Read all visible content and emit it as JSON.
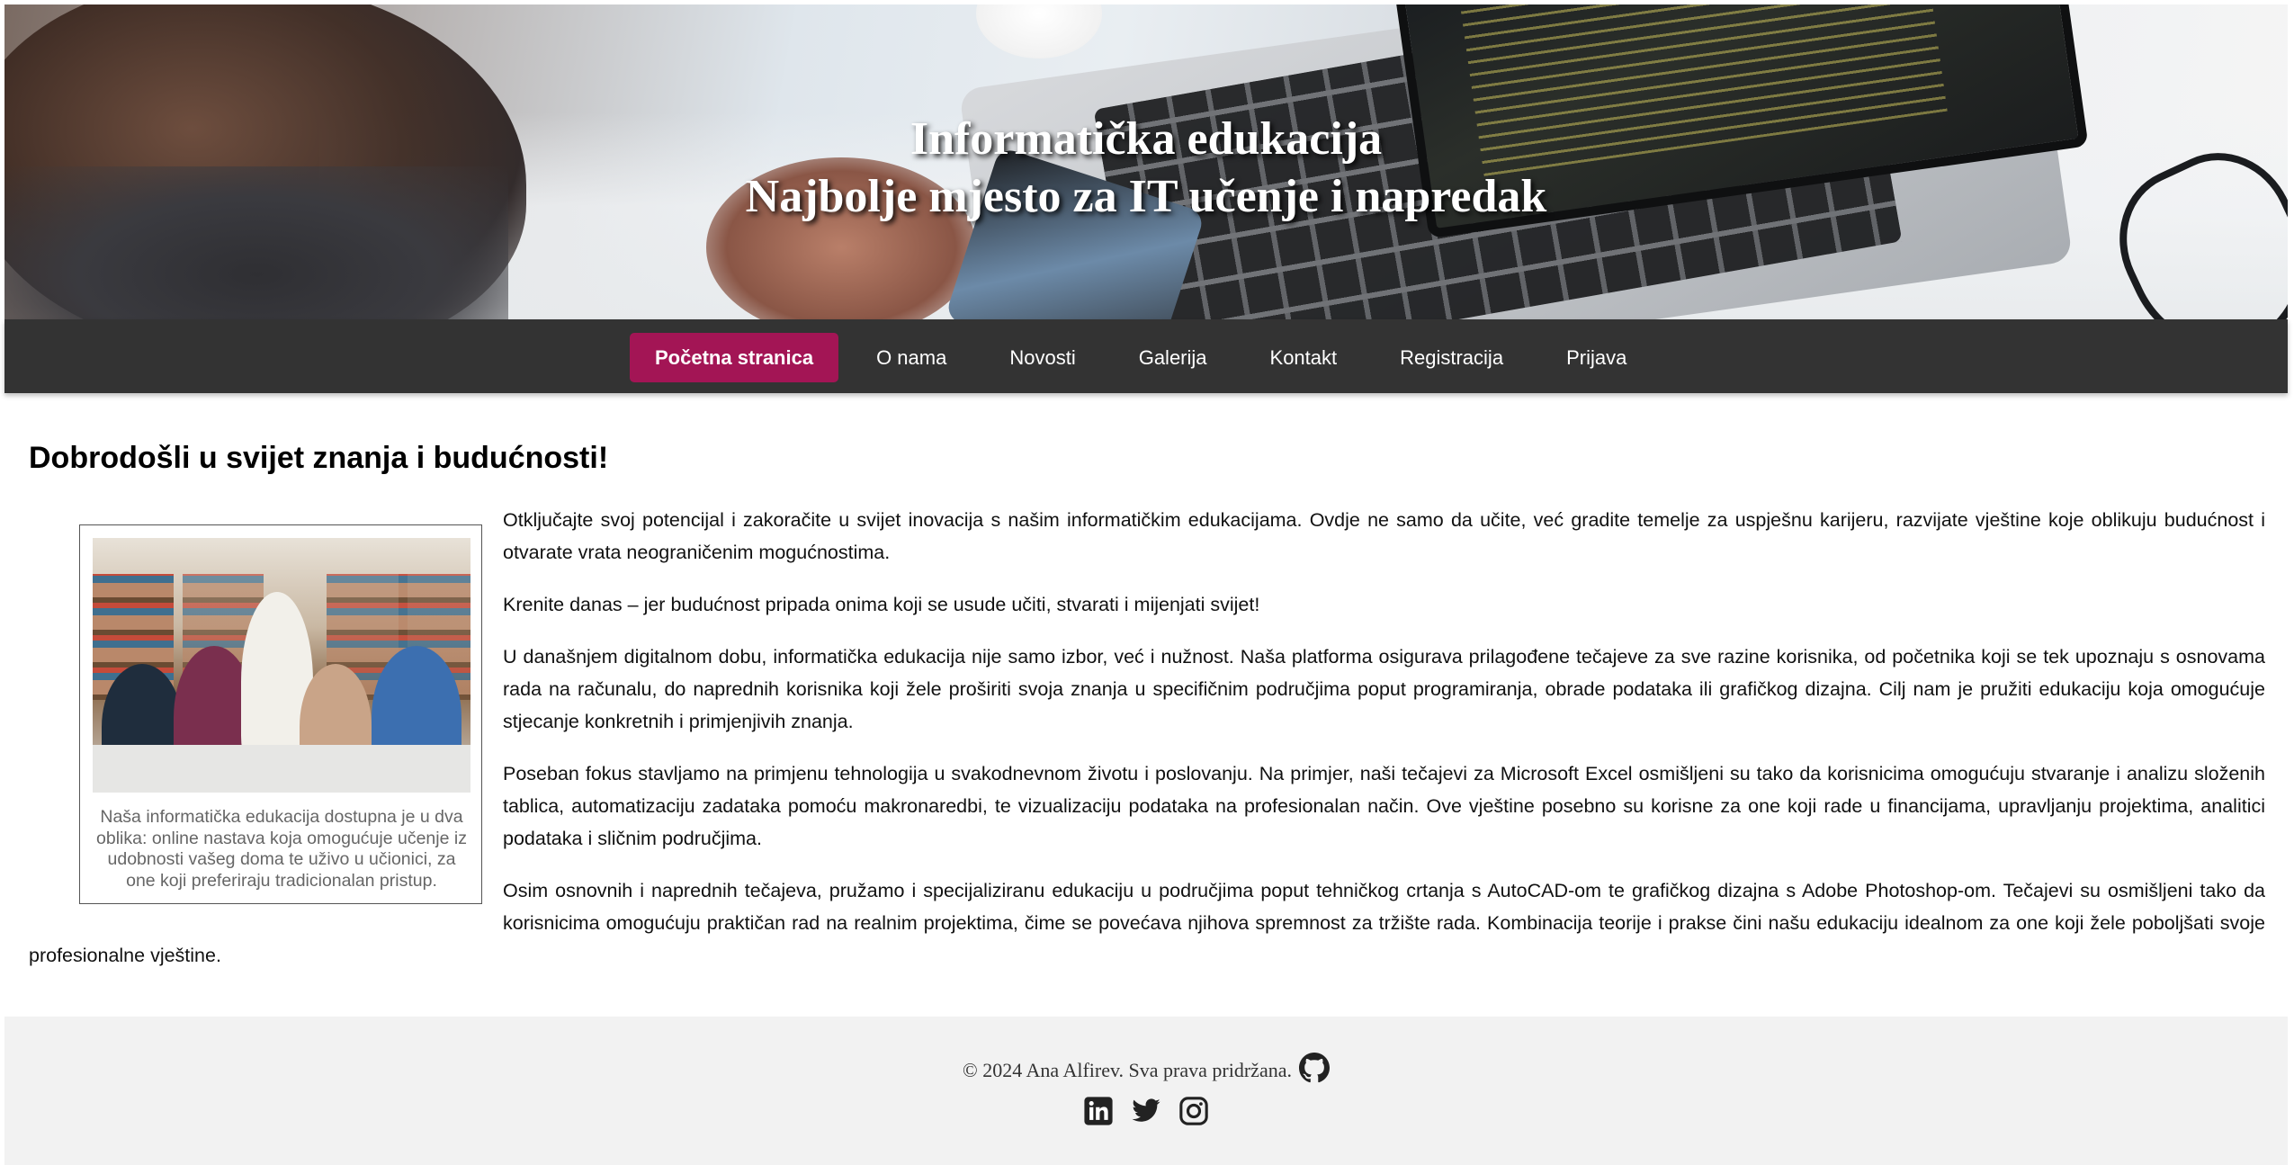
{
  "hero": {
    "title_line1": "Informatička edukacija",
    "title_line2": "Najbolje mjesto za IT učenje i napredak"
  },
  "nav": {
    "items": [
      {
        "label": "Početna stranica",
        "active": true
      },
      {
        "label": "O nama",
        "active": false
      },
      {
        "label": "Novosti",
        "active": false
      },
      {
        "label": "Galerija",
        "active": false
      },
      {
        "label": "Kontakt",
        "active": false
      },
      {
        "label": "Registracija",
        "active": false
      },
      {
        "label": "Prijava",
        "active": false
      }
    ],
    "active_color": "#a31555",
    "background": "#333333"
  },
  "main": {
    "heading": "Dobrodošli u svijet znanja i budućnosti!",
    "figure_caption": "Naša informatička edukacija dostupna je u dva oblika: online nastava koja omogućuje učenje iz udobnosti vašeg doma te uživo u učionici, za one koji preferiraju tradicionalan pristup.",
    "paragraphs": [
      "Otključajte svoj potencijal i zakoračite u svijet inovacija s našim informatičkim edukacijama. Ovdje ne samo da učite, već gradite temelje za uspješnu karijeru, razvijate vještine koje oblikuju budućnost i otvarate vrata neograničenim mogućnostima.",
      "Krenite danas – jer budućnost pripada onima koji se usude učiti, stvarati i mijenjati svijet!",
      "U današnjem digitalnom dobu, informatička edukacija nije samo izbor, već i nužnost. Naša platforma osigurava prilagođene tečajeve za sve razine korisnika, od početnika koji se tek upoznaju s osnovama rada na računalu, do naprednih korisnika koji žele proširiti svoja znanja u specifičnim područjima poput programiranja, obrade podataka ili grafičkog dizajna. Cilj nam je pružiti edukaciju koja omogućuje stjecanje konkretnih i primjenjivih znanja.",
      "Poseban fokus stavljamo na primjenu tehnologija u svakodnevnom životu i poslovanju. Na primjer, naši tečajevi za Microsoft Excel osmišljeni su tako da korisnicima omogućuju stvaranje i analizu složenih tablica, automatizaciju zadataka pomoću makronaredbi, te vizualizaciju podataka na profesionalan način. Ove vještine posebno su korisne za one koji rade u financijama, upravljanju projektima, analitici podataka i sličnim područjima.",
      "Osim osnovnih i naprednih tečajeva, pružamo i specijaliziranu edukaciju u područjima poput tehničkog crtanja s AutoCAD-om te grafičkog dizajna s Adobe Photoshop-om. Tečajevi su osmišljeni tako da korisnicima omogućuju praktičan rad na realnim projektima, čime se povećava njihova spremnost za tržište rada. Kombinacija teorije i prakse čini našu edukaciju idealnom za one koji žele poboljšati svoje profesionalne vještine."
    ]
  },
  "footer": {
    "copyright": "© 2024 Ana Alfirev. Sva prava pridržana.",
    "icons": [
      "github-icon",
      "linkedin-icon",
      "twitter-icon",
      "instagram-icon"
    ]
  }
}
